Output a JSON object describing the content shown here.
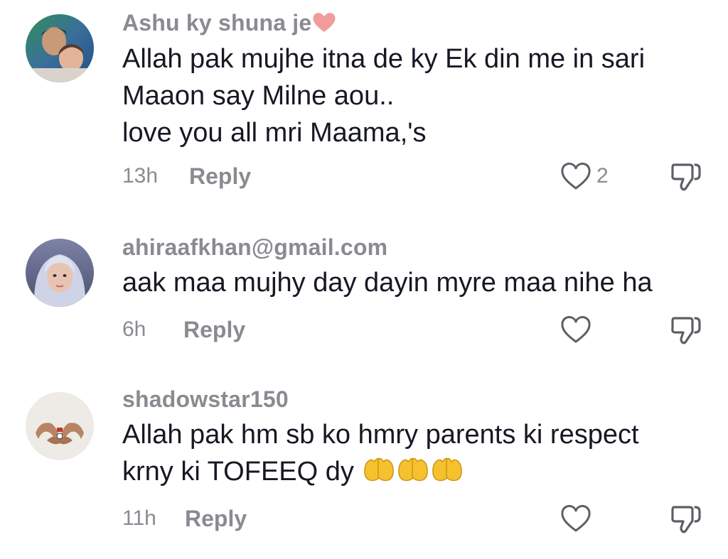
{
  "comments": [
    {
      "username": "Ashu ky shuna je",
      "username_emoji": "heart-emoji",
      "text_lines": [
        "Allah pak mujhe itna de ky Ek din me in sari",
        "Maaon say Milne aou..",
        "love you all mri Maama,'s"
      ],
      "time": "13h",
      "reply_label": "Reply",
      "like_count": "2"
    },
    {
      "username": "ahiraafkhan@gmail.com",
      "text_lines": [
        "aak maa mujhy day dayin myre maa nihe ha"
      ],
      "time": "6h",
      "reply_label": "Reply",
      "like_count": ""
    },
    {
      "username": "shadowstar150",
      "text_lines": [
        "Allah pak hm sb ko hmry parents ki respect",
        "krny ki TOFEEQ dy"
      ],
      "trailing_emoji": [
        "raised-hands-emoji",
        "raised-hands-emoji",
        "raised-hands-emoji"
      ],
      "time": "11h",
      "reply_label": "Reply",
      "like_count": ""
    }
  ],
  "colors": {
    "text": "#161823",
    "muted": "#8a8b91",
    "background": "#ffffff",
    "heart_emoji": "#f29b9b",
    "hands_emoji": "#f5c12e"
  }
}
